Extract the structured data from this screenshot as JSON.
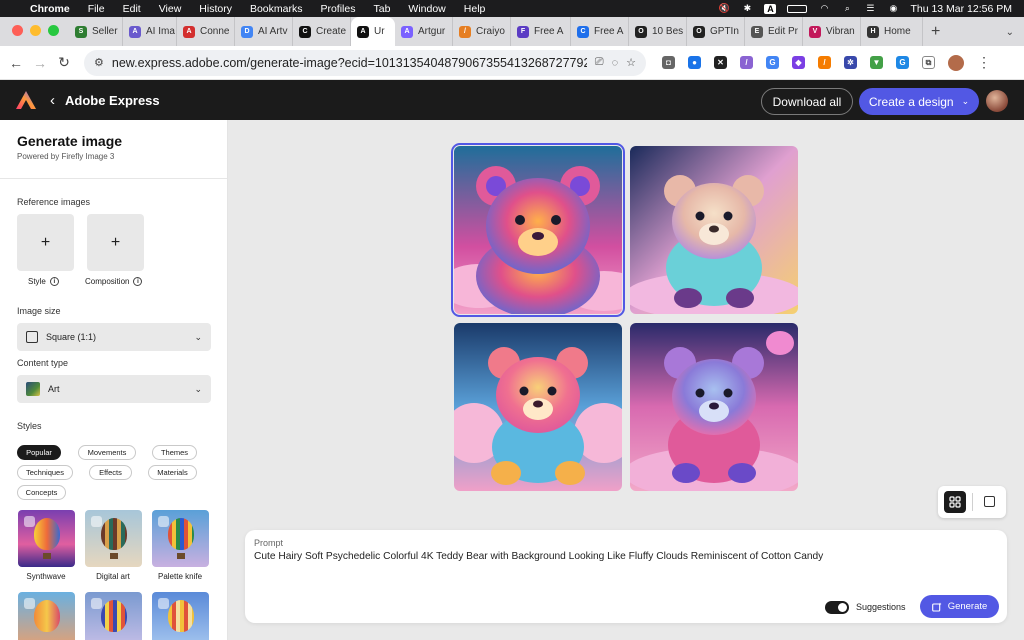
{
  "menubar": {
    "app": "Chrome",
    "items": [
      "File",
      "Edit",
      "View",
      "History",
      "Bookmarks",
      "Profiles",
      "Tab",
      "Window",
      "Help"
    ],
    "datetime": "Thu 13 Mar  12:56 PM"
  },
  "tabs": [
    {
      "label": "Seller",
      "color": "#2e7d32",
      "glyph": "S"
    },
    {
      "label": "AI Ima",
      "color": "#6a5acd",
      "glyph": "A"
    },
    {
      "label": "Conne",
      "color": "#d32f2f",
      "glyph": "A"
    },
    {
      "label": "AI Artv",
      "color": "#4285f4",
      "glyph": "D"
    },
    {
      "label": "Create",
      "color": "#111111",
      "glyph": "C"
    },
    {
      "label": "Ur",
      "color": "#111111",
      "glyph": "A",
      "active": true
    },
    {
      "label": "Artgur",
      "color": "#7b61ff",
      "glyph": "A"
    },
    {
      "label": "Craiyo",
      "color": "#e67e22",
      "glyph": "/"
    },
    {
      "label": "Free A",
      "color": "#5b3cc4",
      "glyph": "F"
    },
    {
      "label": "Free A",
      "color": "#1f6feb",
      "glyph": "C"
    },
    {
      "label": "10 Bes",
      "color": "#222222",
      "glyph": "O"
    },
    {
      "label": "GPTIn",
      "color": "#222222",
      "glyph": "O"
    },
    {
      "label": "Edit Pr",
      "color": "#555555",
      "glyph": "E"
    },
    {
      "label": "Vibran",
      "color": "#c2185b",
      "glyph": "V"
    },
    {
      "label": "Home",
      "color": "#333333",
      "glyph": "H"
    }
  ],
  "address": {
    "url": "new.express.adobe.com/generate-image?ecid=1013135404879067355413268727792177623..."
  },
  "header": {
    "title": "Adobe Express",
    "download_all": "Download all",
    "create_design": "Create a design"
  },
  "panel": {
    "title": "Generate image",
    "subtitle": "Powered by Firefly Image 3",
    "reference_label": "Reference images",
    "ref_style": "Style",
    "ref_composition": "Composition",
    "image_size_label": "Image size",
    "image_size_value": "Square (1:1)",
    "content_type_label": "Content type",
    "content_type_value": "Art",
    "styles_label": "Styles",
    "chips": [
      "Popular",
      "Movements",
      "Themes",
      "Techniques",
      "Effects",
      "Materials",
      "Concepts"
    ],
    "style_thumbs": [
      "Synthwave",
      "Digital art",
      "Palette knife"
    ]
  },
  "prompt": {
    "label": "Prompt",
    "text": "Cute Hairy Soft Psychedelic Colorful 4K Teddy Bear with Background Looking Like Fluffy Clouds Reminiscent of Cotton Candy",
    "suggestions_label": "Suggestions",
    "suggestions_on": true,
    "generate_label": "Generate"
  },
  "colors": {
    "accent": "#5258e4",
    "header_bg": "#1b1b1b",
    "canvas_bg": "#e9e9e9"
  }
}
